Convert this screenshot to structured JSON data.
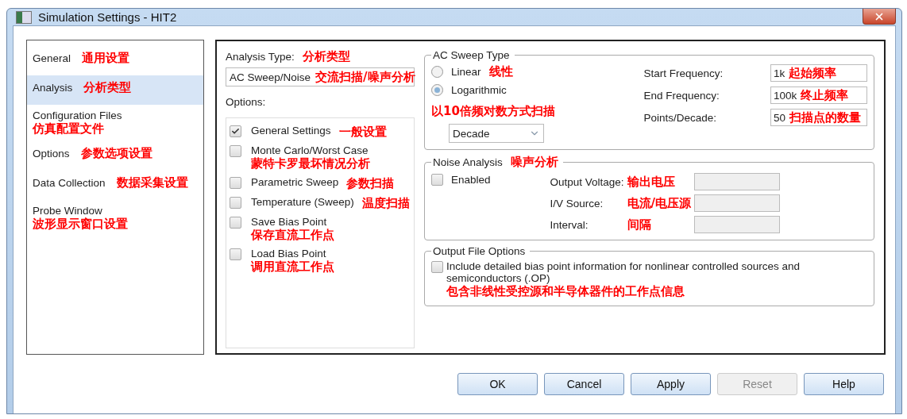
{
  "window": {
    "title": "Simulation Settings - HIT2"
  },
  "nav": {
    "items": [
      {
        "label": "General",
        "note": "通用设置",
        "selected": false
      },
      {
        "label": "Analysis",
        "note": "分析类型",
        "selected": true
      },
      {
        "label": "Configuration Files",
        "note": "仿真配置文件",
        "selected": false
      },
      {
        "label": "Options",
        "note": "参数选项设置",
        "selected": false
      },
      {
        "label": "Data Collection",
        "note": "数据采集设置",
        "selected": false
      },
      {
        "label": "Probe Window",
        "note": "波形显示窗口设置",
        "selected": false
      }
    ]
  },
  "analysis_type": {
    "label": "Analysis Type:",
    "note": "分析类型",
    "value": "AC Sweep/Noise",
    "value_note": "交流扫描/噪声分析"
  },
  "options": {
    "label": "Options:",
    "items": [
      {
        "label": "General Settings",
        "note": "一般设置",
        "checked": true
      },
      {
        "label": "Monte Carlo/Worst Case",
        "note": "蒙特卡罗最坏情况分析",
        "checked": false
      },
      {
        "label": "Parametric Sweep",
        "note": "参数扫描",
        "checked": false
      },
      {
        "label": "Temperature (Sweep)",
        "note": "温度扫描",
        "checked": false
      },
      {
        "label": "Save Bias Point",
        "note": "保存直流工作点",
        "checked": false
      },
      {
        "label": "Load Bias Point",
        "note": "调用直流工作点",
        "checked": false
      }
    ]
  },
  "ac_sweep": {
    "title": "AC Sweep Type",
    "modes": [
      {
        "label": "Linear",
        "note": "线性",
        "selected": false
      },
      {
        "label": "Logarithmic",
        "note": "以10倍频对数方式扫描",
        "selected": true
      }
    ],
    "scale": {
      "value": "Decade"
    },
    "fields": [
      {
        "label": "Start Frequency:",
        "value": "1k",
        "note": "起始频率"
      },
      {
        "label": "End Frequency:",
        "value": "100k",
        "note": "终止频率"
      },
      {
        "label": "Points/Decade:",
        "value": "50",
        "note": "扫描点的数量"
      }
    ]
  },
  "noise": {
    "title": "Noise Analysis",
    "note": "噪声分析",
    "enabled": {
      "label": "Enabled",
      "checked": false
    },
    "fields": [
      {
        "label": "Output Voltage:",
        "note": "输出电压",
        "disabled": true
      },
      {
        "label": "I/V Source:",
        "note": "电流/电压源",
        "disabled": true
      },
      {
        "label": "Interval:",
        "note": "间隔",
        "disabled": true
      }
    ]
  },
  "output_file": {
    "title": "Output File Options",
    "option": {
      "label": "Include detailed bias point information for nonlinear controlled sources and semiconductors (.OP)",
      "note": "包含非线性受控源和半导体器件的工作点信息",
      "checked": false
    }
  },
  "buttons": [
    {
      "label": "OK",
      "disabled": false
    },
    {
      "label": "Cancel",
      "disabled": false
    },
    {
      "label": "Apply",
      "disabled": false
    },
    {
      "label": "Reset",
      "disabled": true
    },
    {
      "label": "Help",
      "disabled": false
    }
  ]
}
